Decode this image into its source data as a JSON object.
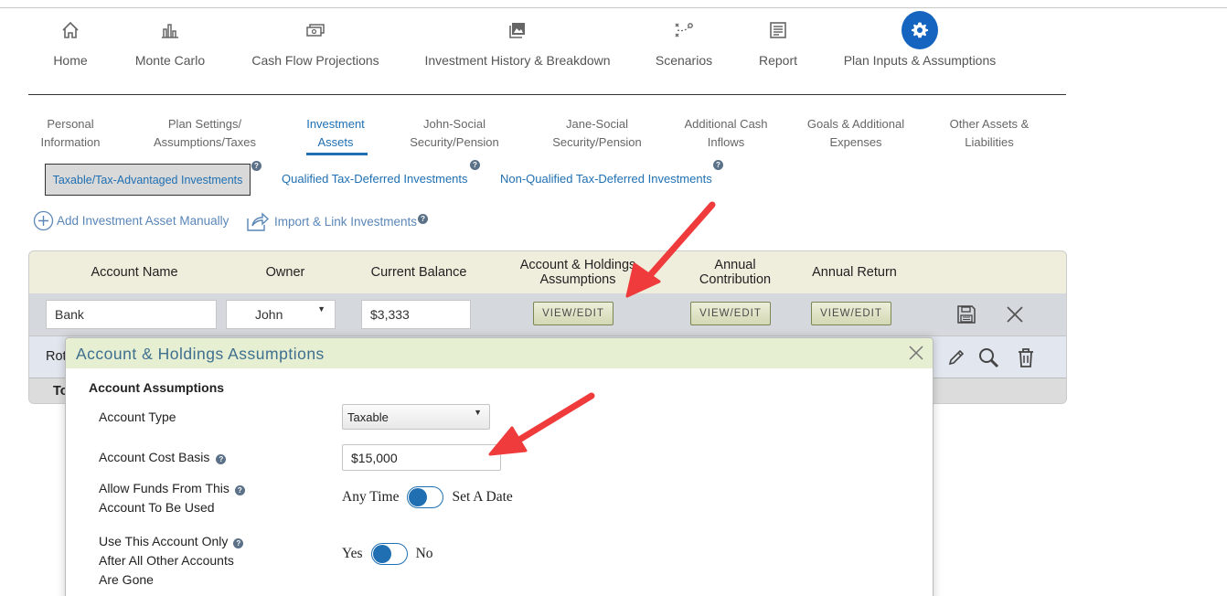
{
  "nav": {
    "items": [
      {
        "label": "Home",
        "icon": "home-icon"
      },
      {
        "label": "Monte Carlo",
        "icon": "bar-chart-icon"
      },
      {
        "label": "Cash Flow Projections",
        "icon": "cash-icon"
      },
      {
        "label": "Investment History & Breakdown",
        "icon": "image-icon"
      },
      {
        "label": "Scenarios",
        "icon": "strategy-icon"
      },
      {
        "label": "Report",
        "icon": "report-icon"
      },
      {
        "label": "Plan Inputs & Assumptions",
        "icon": "gear-icon"
      }
    ],
    "active_color": "#1565c0"
  },
  "subtabs": [
    {
      "line1": "Personal",
      "line2": "Information"
    },
    {
      "line1": "Plan Settings/",
      "line2": "Assumptions/Taxes"
    },
    {
      "line1": "Investment",
      "line2": "Assets"
    },
    {
      "line1": "John-Social",
      "line2": "Security/Pension"
    },
    {
      "line1": "Jane-Social",
      "line2": "Security/Pension"
    },
    {
      "line1": "Additional Cash",
      "line2": "Inflows"
    },
    {
      "line1": "Goals & Additional",
      "line2": "Expenses"
    },
    {
      "line1": "Other Assets &",
      "line2": "Liabilities"
    }
  ],
  "investment_tabs": [
    "Taxable/Tax-Advantaged Investments",
    "Qualified Tax-Deferred Investments",
    "Non-Qualified Tax-Deferred Investments"
  ],
  "actions": {
    "add_manual": "Add Investment Asset Manually",
    "import_link": "Import & Link Investments"
  },
  "table": {
    "headers": {
      "account_name": "Account Name",
      "owner": "Owner",
      "current_balance": "Current Balance",
      "holdings_line1": "Account & Holdings",
      "holdings_line2": "Assumptions",
      "contribution_line1": "Annual",
      "contribution_line2": "Contribution",
      "annual_return": "Annual Return"
    },
    "row1": {
      "account_name": "Bank",
      "owner": "John",
      "balance": "$3,333",
      "view_edit": "VIEW/EDIT"
    },
    "row2_partial": "Rot",
    "row3_partial": "To"
  },
  "modal": {
    "title": "Account & Holdings Assumptions",
    "section_title": "Account Assumptions",
    "account_type_label": "Account Type",
    "account_type_value": "Taxable",
    "cost_basis_label": "Account Cost Basis",
    "cost_basis_value": "$15,000",
    "allow_funds_line1": "Allow Funds From This",
    "allow_funds_line2": "Account To Be Used",
    "allow_funds_left": "Any Time",
    "allow_funds_right": "Set A Date",
    "use_only_line1": "Use This Account Only",
    "use_only_line2": "After All Other Accounts",
    "use_only_line3": "Are Gone",
    "use_only_left": "Yes",
    "use_only_right": "No"
  },
  "colors": {
    "link_blue": "#1f6fb2",
    "annotation_arrow": "#ef3b3b",
    "modal_header_bg": "#e6efd2"
  }
}
